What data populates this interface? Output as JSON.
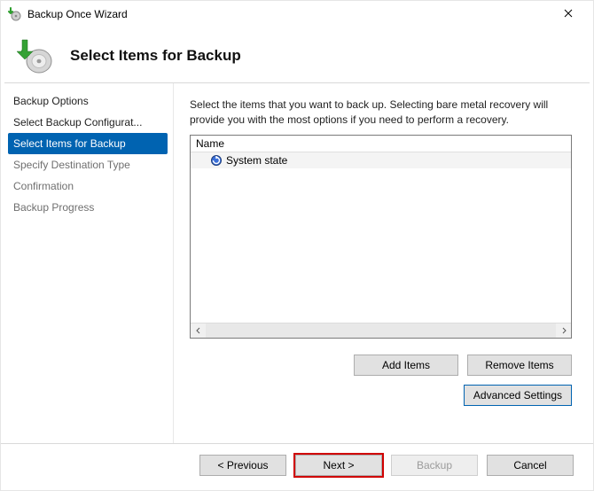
{
  "window": {
    "title": "Backup Once Wizard",
    "close_glyph": "✕"
  },
  "header": {
    "title": "Select Items for Backup"
  },
  "sidebar": {
    "steps": [
      {
        "label": "Backup Options",
        "state": "done"
      },
      {
        "label": "Select Backup Configurat...",
        "state": "done"
      },
      {
        "label": "Select Items for Backup",
        "state": "active"
      },
      {
        "label": "Specify Destination Type",
        "state": "future"
      },
      {
        "label": "Confirmation",
        "state": "future"
      },
      {
        "label": "Backup Progress",
        "state": "future"
      }
    ]
  },
  "main": {
    "instruction": "Select the items that you want to back up. Selecting bare metal recovery will provide you with the most options if you need to perform a recovery.",
    "list_header": "Name",
    "items": [
      {
        "label": "System state"
      }
    ],
    "add_label": "Add Items",
    "remove_label": "Remove Items",
    "advanced_label": "Advanced Settings"
  },
  "footer": {
    "previous": "< Previous",
    "next": "Next >",
    "backup": "Backup",
    "cancel": "Cancel"
  }
}
